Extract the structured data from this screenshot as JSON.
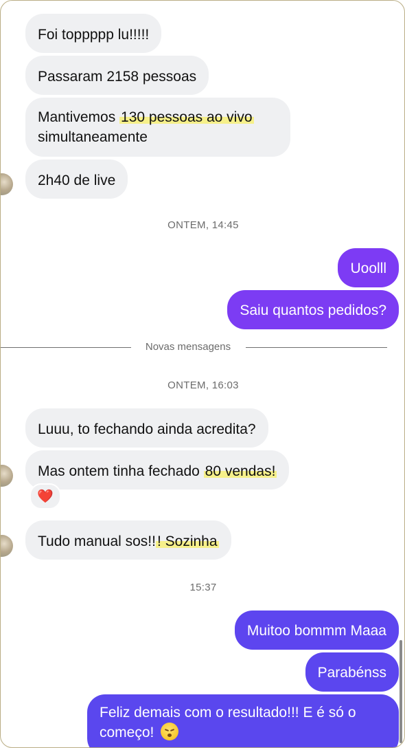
{
  "messages": {
    "m1": "Foi toppppp lu!!!!!",
    "m2": "Passaram 2158 pessoas",
    "m3_pre": "Mantivemos ",
    "m3_hl": "130 pessoas ao vivo",
    "m3_line2": "simultaneamente",
    "m4": "2h40 de live",
    "s1": "Uoolll",
    "s2": "Saiu quantos pedidos?",
    "m5": "Luuu, to fechando ainda acredita?",
    "m6_pre": "Mas ontem tinha fechado ",
    "m6_hl": "80 vendas!",
    "m7_pre": "Tudo manual sos!!",
    "m7_hl": "! Sozinha",
    "s3": "Muitoo bommm Maaa",
    "s4": "Parabénss",
    "s5_line1": "Feliz demais com o resultado!!! E é só o",
    "s5_line2": "começo!"
  },
  "timestamps": {
    "t1": "ONTEM, 14:45",
    "t2": "ONTEM, 16:03",
    "t3": "15:37"
  },
  "divider": {
    "label": "Novas mensagens"
  },
  "reactions": {
    "heart": "❤️"
  },
  "icons": {
    "emoji": "relieved-face-icon",
    "reaction": "red-heart-icon"
  },
  "colors": {
    "incoming_bubble": "#eff0f2",
    "outgoing_purple": "#7a3cf3",
    "outgoing_indigo": "#5b46ef",
    "highlight": "#f6f08a",
    "frame_border": "#b9ad84"
  }
}
